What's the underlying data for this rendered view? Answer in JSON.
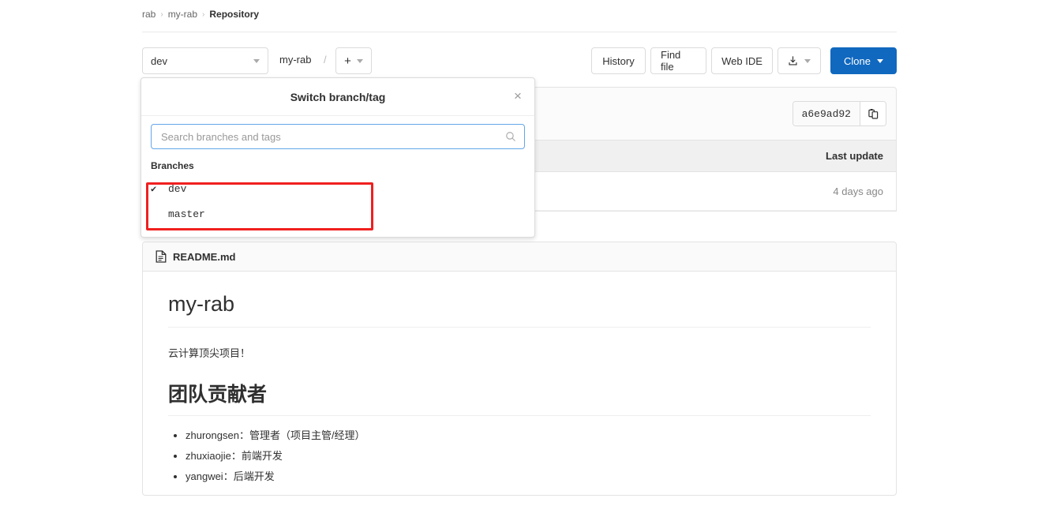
{
  "breadcrumb": {
    "items": [
      {
        "label": "rab",
        "current": false
      },
      {
        "label": "my-rab",
        "current": false
      },
      {
        "label": "Repository",
        "current": true
      }
    ],
    "separator": "›"
  },
  "toolbar": {
    "branch_selector": {
      "value": "dev",
      "icon": "chevron-down-icon"
    },
    "path_label": "my-rab",
    "path_separator": "/",
    "add_button": {
      "plus": "+",
      "icon": "chevron-down-icon"
    },
    "history_label": "History",
    "find_file_label": "Find file",
    "web_ide_label": "Web IDE",
    "download_button": {
      "icon": "download-icon",
      "caret": "chevron-down-icon"
    },
    "clone_button": {
      "label": "Clone",
      "icon": "chevron-down-icon",
      "color": "#1068bf"
    }
  },
  "commit_panel": {
    "sha": "a6e9ad92",
    "copy_icon": "clipboard-copy-icon"
  },
  "files_table": {
    "columns": [
      "",
      "Last update"
    ],
    "rows": [
      {
        "name": "",
        "last_update": "4 days ago"
      }
    ]
  },
  "readme": {
    "file_icon": "document-icon",
    "filename": "README.md",
    "title": "my-rab",
    "paragraph": "云计算顶尖项目！",
    "subtitle": "团队贡献者",
    "contributors": [
      "zhurongsen：管理者（项目主管/经理）",
      "zhuxiaojie：前端开发",
      "yangwei：后端开发"
    ]
  },
  "branch_dropdown": {
    "title": "Switch branch/tag",
    "close_icon": "close-icon",
    "search": {
      "placeholder": "Search branches and tags",
      "value": "",
      "icon": "search-icon"
    },
    "section_label": "Branches",
    "items": [
      {
        "name": "dev",
        "selected": true,
        "check": "✔"
      },
      {
        "name": "master",
        "selected": false,
        "check": "✔"
      }
    ]
  },
  "annotation": {
    "color": "#f01f1f"
  }
}
